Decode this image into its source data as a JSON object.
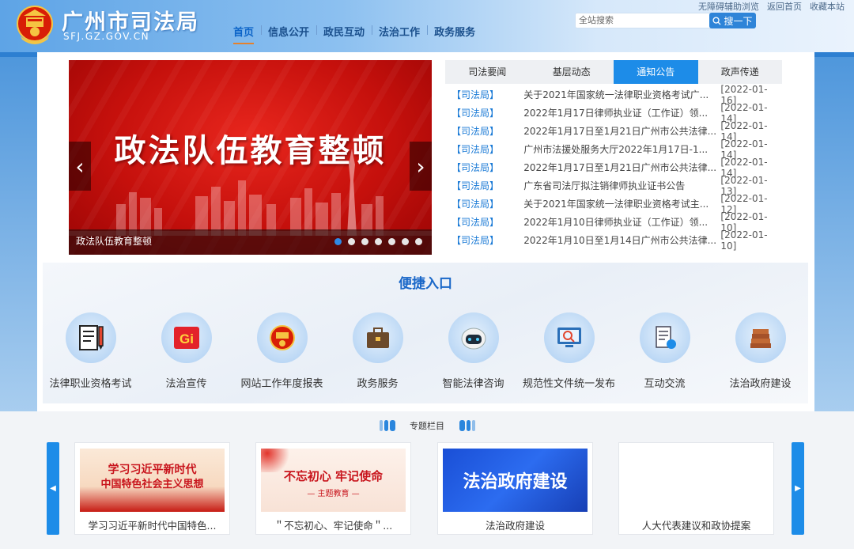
{
  "header": {
    "site_name": "广州市司法局",
    "site_url": "SFJ.GZ.GOV.CN",
    "toplinks": [
      "无障碍辅助浏览",
      "返回首页",
      "收藏本站"
    ],
    "nav": [
      "首页",
      "信息公开",
      "政民互动",
      "法治工作",
      "政务服务"
    ],
    "search_placeholder": "全站搜索",
    "search_button": "搜一下"
  },
  "carousel": {
    "banner_title": "政法队伍教育整顿",
    "caption": "政法队伍教育整顿",
    "slide_count": 7,
    "active_index": 0
  },
  "news": {
    "tabs": [
      "司法要闻",
      "基层动态",
      "通知公告",
      "政声传递"
    ],
    "active_tab": 2,
    "items": [
      {
        "source": "【司法局】",
        "title": "关于2021年国家统一法律职业资格考试广...",
        "date": "[2022-01-16]"
      },
      {
        "source": "【司法局】",
        "title": "2022年1月17日律师执业证（工作证）领...",
        "date": "[2022-01-14]"
      },
      {
        "source": "【司法局】",
        "title": "2022年1月17日至1月21日广州市公共法律...",
        "date": "[2022-01-14]"
      },
      {
        "source": "【司法局】",
        "title": "广州市法援处服务大厅2022年1月17日-1...",
        "date": "[2022-01-14]"
      },
      {
        "source": "【司法局】",
        "title": "2022年1月17日至1月21日广州市公共法律...",
        "date": "[2022-01-14]"
      },
      {
        "source": "【司法局】",
        "title": "广东省司法厅拟注销律师执业证书公告",
        "date": "[2022-01-13]"
      },
      {
        "source": "【司法局】",
        "title": "关于2021年国家统一法律职业资格考试主...",
        "date": "[2022-01-12]"
      },
      {
        "source": "【司法局】",
        "title": "2022年1月10日律师执业证（工作证）领...",
        "date": "[2022-01-10]"
      },
      {
        "source": "【司法局】",
        "title": "2022年1月10日至1月14日广州市公共法律...",
        "date": "[2022-01-10]"
      }
    ]
  },
  "quick": {
    "title": "便捷入口",
    "items": [
      {
        "label": "法律职业资格考试",
        "icon": "document-pen-icon"
      },
      {
        "label": "法治宣传",
        "icon": "gi-logo-icon"
      },
      {
        "label": "网站工作年度报表",
        "icon": "emblem-icon"
      },
      {
        "label": "政务服务",
        "icon": "briefcase-icon"
      },
      {
        "label": "智能法律咨询",
        "icon": "robot-icon"
      },
      {
        "label": "规范性文件统一发布",
        "icon": "monitor-search-icon"
      },
      {
        "label": "互动交流",
        "icon": "document-chat-icon"
      },
      {
        "label": "法治政府建设",
        "icon": "books-icon"
      }
    ]
  },
  "topics": {
    "heading": "专题栏目",
    "cards": [
      {
        "label": "学习习近平新时代中国特色...",
        "img_text_1": "学习习近平新时代",
        "img_text_2": "中国特色社会主义思想"
      },
      {
        "label": "＂不忘初心、牢记使命＂...",
        "img_text_1": "不忘初心 牢记使命",
        "img_text_2": "— 主题教育 —"
      },
      {
        "label": "法治政府建设",
        "img_text_1": "法治政府建设",
        "img_text_2": ""
      },
      {
        "label": "人大代表建议和政协提案",
        "img_text_1": "",
        "img_text_2": ""
      }
    ]
  },
  "colors": {
    "primary": "#1d8ce8",
    "link": "#1a7ad6",
    "banner_red": "#c5100c",
    "nav_underline": "#e5812c"
  }
}
